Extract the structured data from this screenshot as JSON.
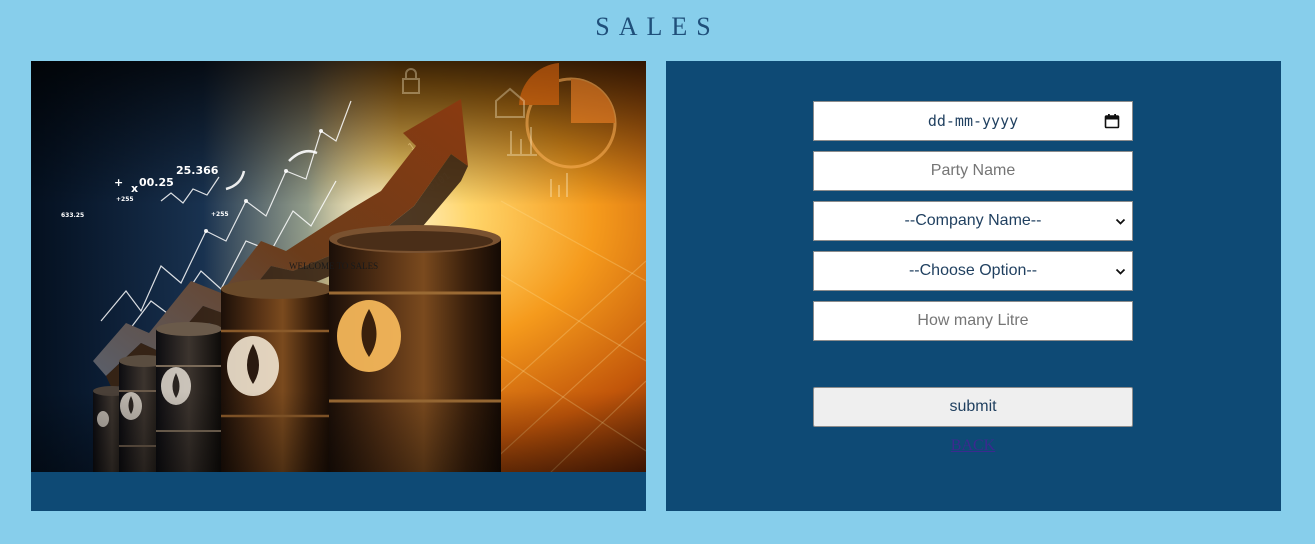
{
  "header": {
    "title": "SALES"
  },
  "hero": {
    "welcome_text": "WELCOME TO SALES",
    "chart_numbers": [
      "25.366",
      "00.25",
      "+255",
      "633.25",
      "+255"
    ]
  },
  "form": {
    "date": {
      "placeholder": "dd-mm-yyyy",
      "icon": "calendar-icon"
    },
    "party_name": {
      "placeholder": "Party Name",
      "value": ""
    },
    "company": {
      "selected": "--Company Name--",
      "icon": "chevron-down-icon"
    },
    "option": {
      "selected": "--Choose Option--",
      "icon": "chevron-down-icon"
    },
    "litre": {
      "placeholder": "How many Litre",
      "value": ""
    },
    "submit_label": "submit",
    "back_label": "BACK"
  },
  "colors": {
    "background": "#87ceeb",
    "panel": "#0e4a75",
    "title": "#1f4f7a",
    "link": "#3b2a8f"
  }
}
